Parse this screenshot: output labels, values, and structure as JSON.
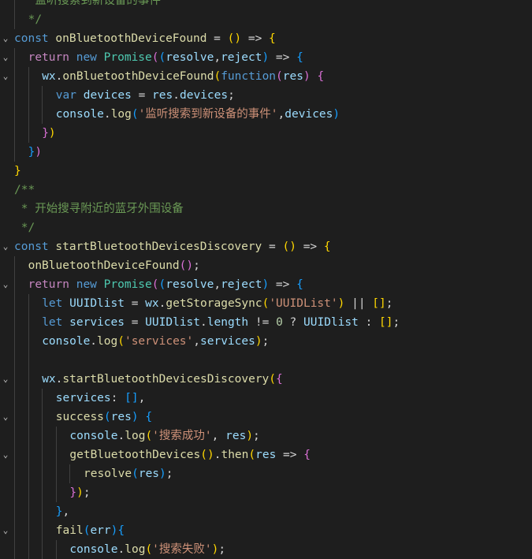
{
  "editor": {
    "theme_colors": {
      "background": "#1e1e1e",
      "keyword": "#569cd6",
      "function": "#dcdcaa",
      "string": "#ce9178",
      "comment": "#6a9955",
      "variable": "#9cdcfe",
      "class": "#4ec9b0"
    },
    "lines": [
      {
        "indent": 1,
        "fold": false,
        "tokens": [
          [
            "cmt",
            " 监听搜索到新设备的事件"
          ]
        ]
      },
      {
        "indent": 1,
        "fold": false,
        "tokens": [
          [
            "cmt",
            "*/"
          ]
        ]
      },
      {
        "indent": 0,
        "fold": true,
        "tokens": [
          [
            "kw",
            "const"
          ],
          [
            "pun",
            " "
          ],
          [
            "fn",
            "onBluetoothDeviceFound"
          ],
          [
            "pun",
            " = "
          ],
          [
            "b1",
            "()"
          ],
          [
            "pun",
            " => "
          ],
          [
            "b1",
            "{"
          ]
        ]
      },
      {
        "indent": 1,
        "fold": true,
        "tokens": [
          [
            "ctl",
            "return"
          ],
          [
            "pun",
            " "
          ],
          [
            "kw",
            "new"
          ],
          [
            "pun",
            " "
          ],
          [
            "cls",
            "Promise"
          ],
          [
            "b2",
            "("
          ],
          [
            "b3",
            "("
          ],
          [
            "param",
            "resolve"
          ],
          [
            "pun",
            ","
          ],
          [
            "param",
            "reject"
          ],
          [
            "b3",
            ")"
          ],
          [
            "pun",
            " => "
          ],
          [
            "b3",
            "{"
          ]
        ]
      },
      {
        "indent": 2,
        "fold": true,
        "tokens": [
          [
            "var",
            "wx"
          ],
          [
            "pun",
            "."
          ],
          [
            "fn",
            "onBluetoothDeviceFound"
          ],
          [
            "b1",
            "("
          ],
          [
            "kw",
            "function"
          ],
          [
            "b2",
            "("
          ],
          [
            "param",
            "res"
          ],
          [
            "b2",
            ")"
          ],
          [
            "pun",
            " "
          ],
          [
            "b2",
            "{"
          ]
        ]
      },
      {
        "indent": 3,
        "fold": false,
        "tokens": [
          [
            "kw",
            "var"
          ],
          [
            "pun",
            " "
          ],
          [
            "var",
            "devices"
          ],
          [
            "pun",
            " = "
          ],
          [
            "var",
            "res"
          ],
          [
            "pun",
            "."
          ],
          [
            "var",
            "devices"
          ],
          [
            "pun",
            ";"
          ]
        ]
      },
      {
        "indent": 3,
        "fold": false,
        "tokens": [
          [
            "var",
            "console"
          ],
          [
            "pun",
            "."
          ],
          [
            "fn",
            "log"
          ],
          [
            "b3",
            "("
          ],
          [
            "str",
            "'监听搜索到新设备的事件'"
          ],
          [
            "pun",
            ","
          ],
          [
            "var",
            "devices"
          ],
          [
            "b3",
            ")"
          ]
        ]
      },
      {
        "indent": 2,
        "fold": false,
        "tokens": [
          [
            "b2",
            "}"
          ],
          [
            "b1",
            ")"
          ]
        ]
      },
      {
        "indent": 1,
        "fold": false,
        "tokens": [
          [
            "b3",
            "}"
          ],
          [
            "b2",
            ")"
          ]
        ]
      },
      {
        "indent": 0,
        "fold": false,
        "tokens": [
          [
            "b1",
            "}"
          ]
        ]
      },
      {
        "indent": 0,
        "fold": false,
        "tokens": [
          [
            "cmt",
            "/**"
          ]
        ]
      },
      {
        "indent": 0,
        "fold": false,
        "tokens": [
          [
            "cmt",
            " * 开始搜寻附近的蓝牙外围设备"
          ]
        ]
      },
      {
        "indent": 0,
        "fold": false,
        "tokens": [
          [
            "cmt",
            " */"
          ]
        ]
      },
      {
        "indent": 0,
        "fold": true,
        "tokens": [
          [
            "kw",
            "const"
          ],
          [
            "pun",
            " "
          ],
          [
            "fn",
            "startBluetoothDevicesDiscovery"
          ],
          [
            "pun",
            " = "
          ],
          [
            "b1",
            "()"
          ],
          [
            "pun",
            " => "
          ],
          [
            "b1",
            "{"
          ]
        ]
      },
      {
        "indent": 1,
        "fold": false,
        "tokens": [
          [
            "fn",
            "onBluetoothDeviceFound"
          ],
          [
            "b2",
            "()"
          ],
          [
            "pun",
            ";"
          ]
        ]
      },
      {
        "indent": 1,
        "fold": true,
        "tokens": [
          [
            "ctl",
            "return"
          ],
          [
            "pun",
            " "
          ],
          [
            "kw",
            "new"
          ],
          [
            "pun",
            " "
          ],
          [
            "cls",
            "Promise"
          ],
          [
            "b2",
            "("
          ],
          [
            "b3",
            "("
          ],
          [
            "param",
            "resolve"
          ],
          [
            "pun",
            ","
          ],
          [
            "param",
            "reject"
          ],
          [
            "b3",
            ")"
          ],
          [
            "pun",
            " => "
          ],
          [
            "b3",
            "{"
          ]
        ]
      },
      {
        "indent": 2,
        "fold": false,
        "tokens": [
          [
            "kw",
            "let"
          ],
          [
            "pun",
            " "
          ],
          [
            "var",
            "UUIDlist"
          ],
          [
            "pun",
            " = "
          ],
          [
            "var",
            "wx"
          ],
          [
            "pun",
            "."
          ],
          [
            "fn",
            "getStorageSync"
          ],
          [
            "b1",
            "("
          ],
          [
            "str",
            "'UUIDList'"
          ],
          [
            "b1",
            ")"
          ],
          [
            "pun",
            " || "
          ],
          [
            "b1",
            "[]"
          ],
          [
            "pun",
            ";"
          ]
        ]
      },
      {
        "indent": 2,
        "fold": false,
        "tokens": [
          [
            "kw",
            "let"
          ],
          [
            "pun",
            " "
          ],
          [
            "var",
            "services"
          ],
          [
            "pun",
            " = "
          ],
          [
            "var",
            "UUIDlist"
          ],
          [
            "pun",
            "."
          ],
          [
            "var",
            "length"
          ],
          [
            "pun",
            " != "
          ],
          [
            "num",
            "0"
          ],
          [
            "pun",
            " ? "
          ],
          [
            "var",
            "UUIDlist"
          ],
          [
            "pun",
            " : "
          ],
          [
            "b1",
            "[]"
          ],
          [
            "pun",
            ";"
          ]
        ]
      },
      {
        "indent": 2,
        "fold": false,
        "tokens": [
          [
            "var",
            "console"
          ],
          [
            "pun",
            "."
          ],
          [
            "fn",
            "log"
          ],
          [
            "b1",
            "("
          ],
          [
            "str",
            "'services'"
          ],
          [
            "pun",
            ","
          ],
          [
            "var",
            "services"
          ],
          [
            "b1",
            ")"
          ],
          [
            "pun",
            ";"
          ]
        ]
      },
      {
        "indent": 2,
        "fold": false,
        "tokens": []
      },
      {
        "indent": 2,
        "fold": true,
        "tokens": [
          [
            "var",
            "wx"
          ],
          [
            "pun",
            "."
          ],
          [
            "fn",
            "startBluetoothDevicesDiscovery"
          ],
          [
            "b1",
            "("
          ],
          [
            "b2",
            "{"
          ]
        ]
      },
      {
        "indent": 3,
        "fold": false,
        "tokens": [
          [
            "var",
            "services"
          ],
          [
            "pun",
            ": "
          ],
          [
            "b3",
            "[]"
          ],
          [
            "pun",
            ","
          ]
        ]
      },
      {
        "indent": 3,
        "fold": true,
        "tokens": [
          [
            "fn",
            "success"
          ],
          [
            "b3",
            "("
          ],
          [
            "param",
            "res"
          ],
          [
            "b3",
            ")"
          ],
          [
            "pun",
            " "
          ],
          [
            "b3",
            "{"
          ]
        ]
      },
      {
        "indent": 4,
        "fold": false,
        "tokens": [
          [
            "var",
            "console"
          ],
          [
            "pun",
            "."
          ],
          [
            "fn",
            "log"
          ],
          [
            "b1",
            "("
          ],
          [
            "str",
            "'搜索成功'"
          ],
          [
            "pun",
            ", "
          ],
          [
            "var",
            "res"
          ],
          [
            "b1",
            ")"
          ],
          [
            "pun",
            ";"
          ]
        ]
      },
      {
        "indent": 4,
        "fold": true,
        "tokens": [
          [
            "fn",
            "getBluetoothDevices"
          ],
          [
            "b1",
            "()"
          ],
          [
            "pun",
            "."
          ],
          [
            "fn",
            "then"
          ],
          [
            "b1",
            "("
          ],
          [
            "param",
            "res"
          ],
          [
            "pun",
            " => "
          ],
          [
            "b2",
            "{"
          ]
        ]
      },
      {
        "indent": 5,
        "fold": false,
        "tokens": [
          [
            "fn",
            "resolve"
          ],
          [
            "b3",
            "("
          ],
          [
            "var",
            "res"
          ],
          [
            "b3",
            ")"
          ],
          [
            "pun",
            ";"
          ]
        ]
      },
      {
        "indent": 4,
        "fold": false,
        "tokens": [
          [
            "b2",
            "}"
          ],
          [
            "b1",
            ")"
          ],
          [
            "pun",
            ";"
          ]
        ]
      },
      {
        "indent": 3,
        "fold": false,
        "tokens": [
          [
            "b3",
            "}"
          ],
          [
            "pun",
            ","
          ]
        ]
      },
      {
        "indent": 3,
        "fold": true,
        "tokens": [
          [
            "fn",
            "fail"
          ],
          [
            "b3",
            "("
          ],
          [
            "param",
            "err"
          ],
          [
            "b3",
            ")"
          ],
          [
            "b3",
            "{"
          ]
        ]
      },
      {
        "indent": 4,
        "fold": false,
        "tokens": [
          [
            "var",
            "console"
          ],
          [
            "pun",
            "."
          ],
          [
            "fn",
            "log"
          ],
          [
            "b1",
            "("
          ],
          [
            "str",
            "'搜索失败'"
          ],
          [
            "b1",
            ")"
          ],
          [
            "pun",
            ";"
          ]
        ]
      }
    ]
  }
}
